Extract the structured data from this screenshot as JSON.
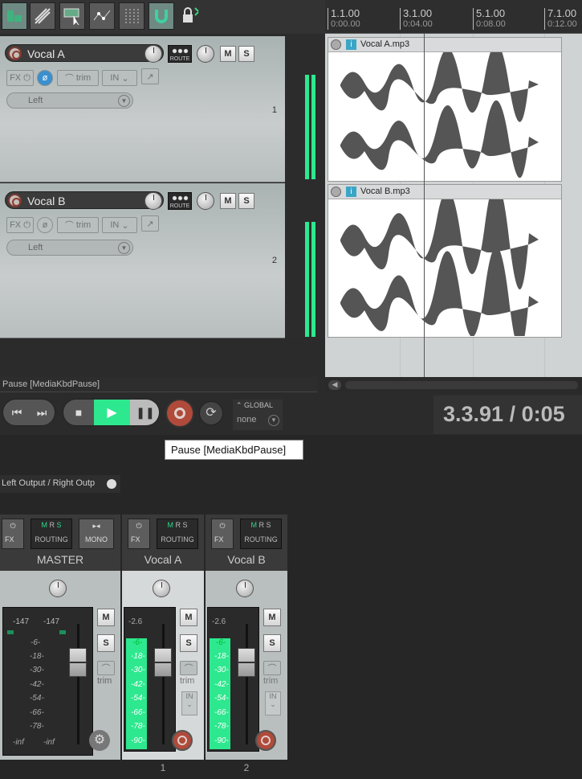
{
  "toolbar": {
    "buttons": [
      "grid-toggle",
      "ripple-edit",
      "item-tool",
      "envelope-points",
      "snap-grid",
      "snap-magnet",
      "lock"
    ]
  },
  "ruler": {
    "marks": [
      {
        "bar": "1.1.00",
        "time": "0:00.00"
      },
      {
        "bar": "3.1.00",
        "time": "0:04.00"
      },
      {
        "bar": "5.1.00",
        "time": "0:08.00"
      },
      {
        "bar": "7.1.00",
        "time": "0:12.00"
      }
    ]
  },
  "tracks": [
    {
      "name": "Vocal A",
      "num": "1",
      "fx": "FX",
      "trim": "trim",
      "in": "IN",
      "pan": "Left",
      "route": "ROUTE",
      "m": "M",
      "s": "S",
      "item": "Vocal A.mp3"
    },
    {
      "name": "Vocal B",
      "num": "2",
      "fx": "FX",
      "trim": "trim",
      "in": "IN",
      "pan": "Left",
      "route": "ROUTE",
      "m": "M",
      "s": "S",
      "item": "Vocal B.mp3"
    }
  ],
  "status_left": "Pause [MediaKbdPause]",
  "transport": {
    "global_label": "GLOBAL",
    "global_value": "none",
    "time": "3.3.91 / 0:05"
  },
  "tooltip": "Pause [MediaKbdPause]",
  "mixer": {
    "output_label": "Left Output / Right Outp",
    "strips": [
      {
        "name": "MASTER",
        "fx": "FX",
        "routing": "ROUTING",
        "mono": "MONO",
        "peak_l": "-147",
        "peak_r": "-147",
        "scale": [
          "-6-",
          "-18-",
          "-30-",
          "-42-",
          "-54-",
          "-66-",
          "-78-"
        ],
        "inf_l": "-inf",
        "inf_r": "-inf",
        "m": "M",
        "s": "S",
        "trim": "trim",
        "num": ""
      },
      {
        "name": "Vocal A",
        "fx": "FX",
        "routing": "ROUTING",
        "peak": "-2.6",
        "scale": [
          "-6-",
          "-18-",
          "-30-",
          "-42-",
          "-54-",
          "-66-",
          "-78-",
          "-90-"
        ],
        "m": "M",
        "s": "S",
        "trim": "trim",
        "in": "IN",
        "num": "1",
        "level": 0.86
      },
      {
        "name": "Vocal B",
        "fx": "FX",
        "routing": "ROUTING",
        "peak": "-2.6",
        "scale": [
          "-6-",
          "-18-",
          "-30-",
          "-42-",
          "-54-",
          "-66-",
          "-78-",
          "-90-"
        ],
        "m": "M",
        "s": "S",
        "trim": "trim",
        "in": "IN",
        "num": "2",
        "level": 0.86
      }
    ]
  },
  "colors": {
    "meter": "#2de88e",
    "accent": "#2de88e",
    "item_info": "#3aa6c6",
    "record": "#b04a3a"
  }
}
